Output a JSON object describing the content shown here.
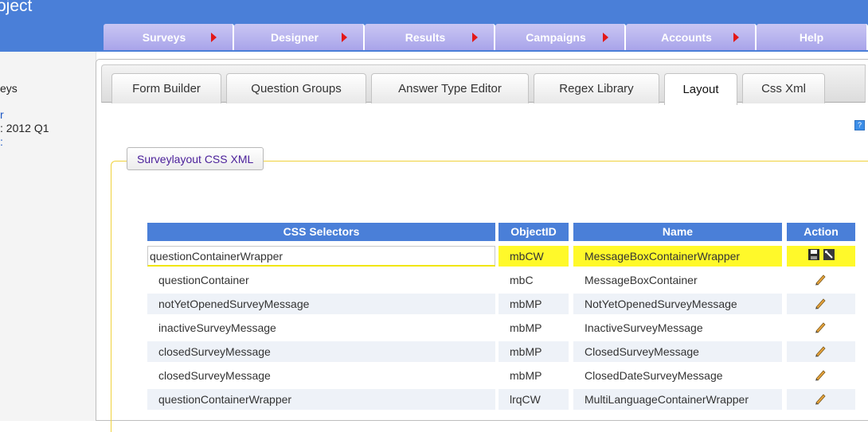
{
  "app": {
    "title": "oject"
  },
  "nav": {
    "tabs": [
      {
        "label": "Surveys"
      },
      {
        "label": "Designer"
      },
      {
        "label": "Results"
      },
      {
        "label": "Campaigns"
      },
      {
        "label": "Accounts"
      },
      {
        "label": "Help"
      }
    ]
  },
  "sidebar": {
    "items": [
      {
        "label": "eys"
      },
      {
        "label": "r"
      },
      {
        "label": ": 2012 Q1"
      },
      {
        "label": ":"
      }
    ]
  },
  "subtabs": [
    {
      "label": "Form Builder"
    },
    {
      "label": "Question Groups"
    },
    {
      "label": "Answer Type Editor"
    },
    {
      "label": "Regex Library"
    },
    {
      "label": "Layout"
    },
    {
      "label": "Css Xml"
    }
  ],
  "section": {
    "legend": "Surveylayout CSS XML"
  },
  "table": {
    "headers": {
      "selectors": "CSS Selectors",
      "objectid": "ObjectID",
      "name": "Name",
      "action": "Action"
    },
    "rows": [
      {
        "selector": "questionContainerWrapper",
        "objectid": "mbCW",
        "name": "MessageBoxContainerWrapper"
      },
      {
        "selector": "questionContainer",
        "objectid": "mbC",
        "name": "MessageBoxContainer"
      },
      {
        "selector": "notYetOpenedSurveyMessage",
        "objectid": "mbMP",
        "name": "NotYetOpenedSurveyMessage"
      },
      {
        "selector": "inactiveSurveyMessage",
        "objectid": "mbMP",
        "name": "InactiveSurveyMessage"
      },
      {
        "selector": "closedSurveyMessage",
        "objectid": "mbMP",
        "name": "ClosedSurveyMessage"
      },
      {
        "selector": "closedSurveyMessage",
        "objectid": "mbMP",
        "name": "ClosedDateSurveyMessage"
      },
      {
        "selector": "questionContainerWrapper",
        "objectid": "lrqCW",
        "name": "MultiLanguageContainerWrapper"
      }
    ]
  },
  "colors": {
    "header_blue": "#4a7fd8",
    "tab_purple": "#b4b0ee",
    "arrow_red": "#e31818",
    "highlight_yellow": "#fff92a",
    "legend_purple": "#4a1f9a"
  },
  "icons": [
    "save-icon",
    "cancel-icon",
    "edit-pencil-icon",
    "help-icon",
    "arrow-right-icon"
  ]
}
